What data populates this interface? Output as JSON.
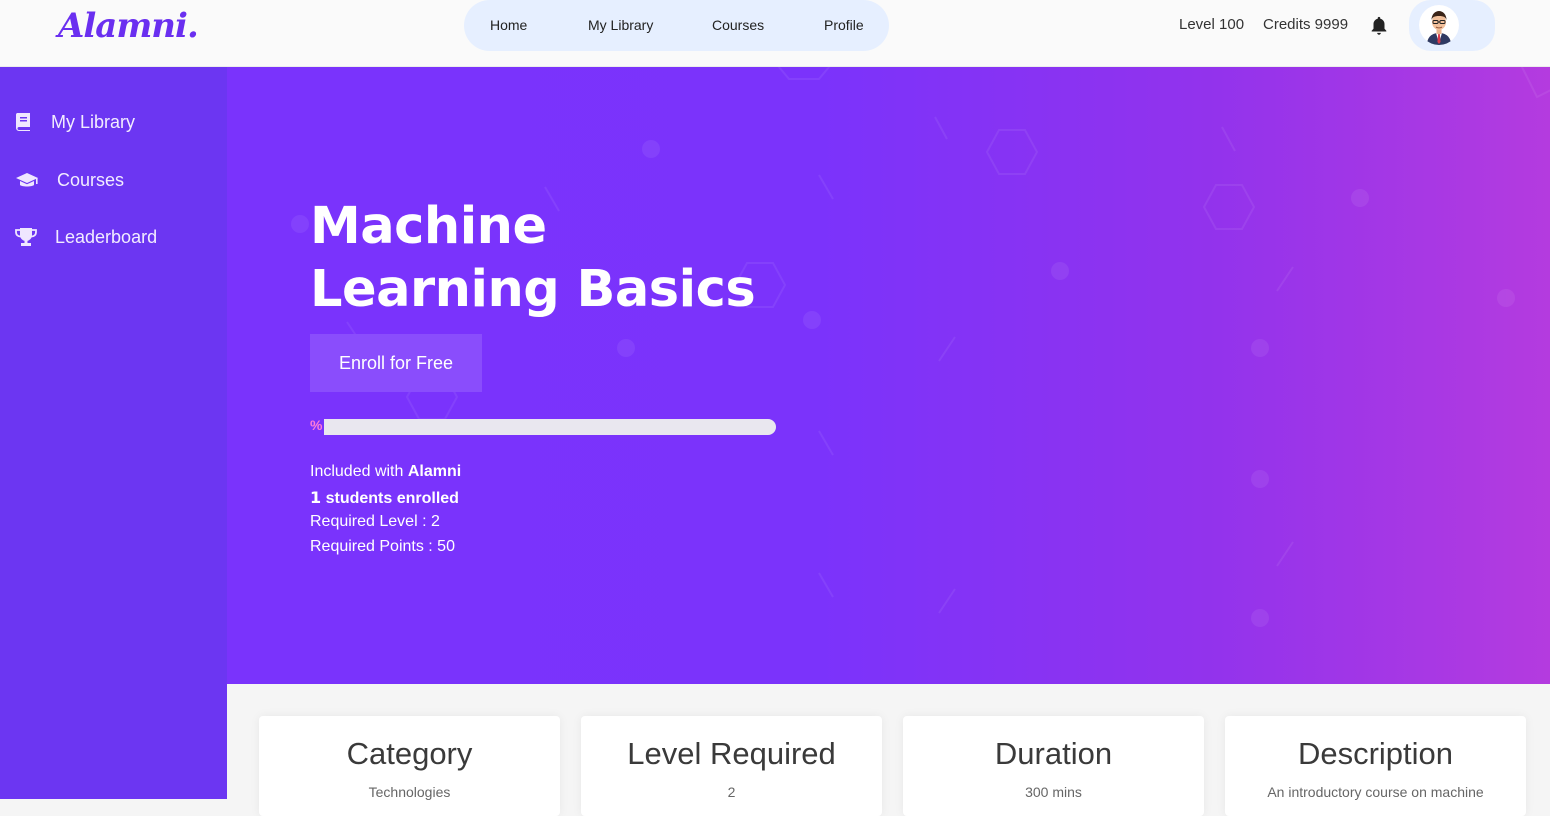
{
  "app": {
    "logo": "Alamni."
  },
  "nav": {
    "links": [
      "Home",
      "My Library",
      "Courses",
      "Profile"
    ]
  },
  "user": {
    "level": "Level 100",
    "credits": "Credits 9999"
  },
  "sidebar": {
    "items": [
      {
        "label": "My Library",
        "icon": "book-icon"
      },
      {
        "label": "Courses",
        "icon": "graduation-cap-icon"
      },
      {
        "label": "Leaderboard",
        "icon": "trophy-icon"
      }
    ]
  },
  "course": {
    "title_line1": "Machine",
    "title_line2": "Learning Basics",
    "enroll_label": "Enroll for Free",
    "progress_label": "%",
    "progress_fraction": 0,
    "included_prefix": "Included with ",
    "included_brand": "Alamni",
    "students_count": "1",
    "students_suffix": " students enrolled",
    "required_level": "Required Level : 2",
    "required_points": "Required Points : 50"
  },
  "cards": [
    {
      "title": "Category",
      "value": "Technologies"
    },
    {
      "title": "Level Required",
      "value": "2"
    },
    {
      "title": "Duration",
      "value": "300 mins"
    },
    {
      "title": "Description",
      "value": "An introductory course on machine"
    }
  ],
  "colors": {
    "brand": "#6a2ff0",
    "sidebar": "#6c36f2",
    "hero_start": "#7a33fc",
    "hero_end": "#b43bdf",
    "progress": "#ff7cd8"
  }
}
